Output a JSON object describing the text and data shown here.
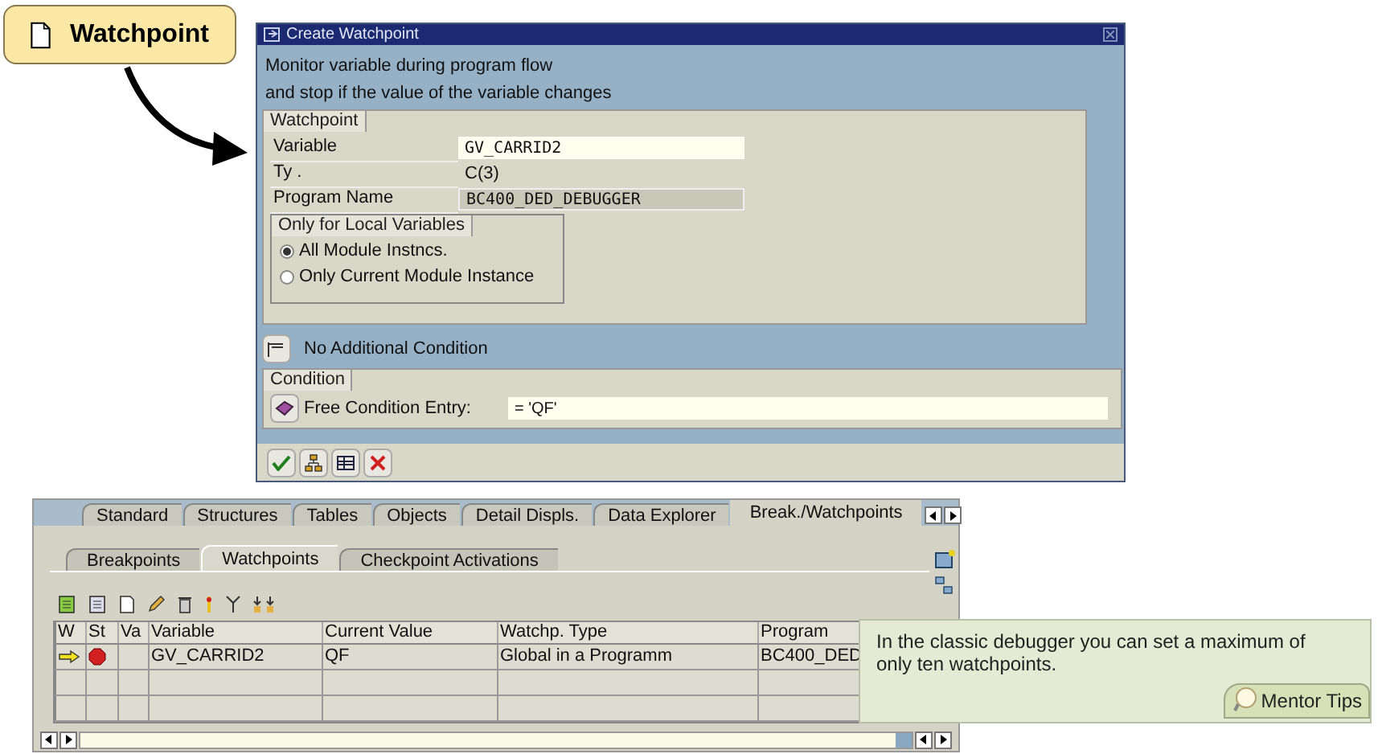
{
  "callout": {
    "label": "Watchpoint"
  },
  "dialog": {
    "title": "Create Watchpoint",
    "intro": [
      "Monitor variable during program flow",
      "and stop if the value of the variable changes"
    ],
    "watchpoint_group": {
      "title": "Watchpoint",
      "fields": [
        {
          "label": "Variable",
          "value": "GV_CARRID2",
          "kind": "input"
        },
        {
          "label": "Ty .",
          "value": "C(3)",
          "kind": "text"
        },
        {
          "label": "Program Name",
          "value": "BC400_DED_DEBUGGER",
          "kind": "readonly"
        }
      ]
    },
    "local_group": {
      "title": "Only for Local Variables",
      "options": [
        {
          "label": "All Module Instncs.",
          "selected": true
        },
        {
          "label": "Only Current Module Instance",
          "selected": false
        }
      ]
    },
    "condition_toggle": "No Additional Condition",
    "condition_group": {
      "title": "Condition",
      "label": "Free Condition Entry:",
      "value": "= 'QF'"
    }
  },
  "debugger": {
    "tabs": [
      {
        "label": "Standard",
        "selected": false
      },
      {
        "label": "Structures",
        "selected": false
      },
      {
        "label": "Tables",
        "selected": false
      },
      {
        "label": "Objects",
        "selected": false
      },
      {
        "label": "Detail Displs.",
        "selected": false
      },
      {
        "label": "Data Explorer",
        "selected": false
      },
      {
        "label": "Break./Watchpoints",
        "selected": true
      }
    ],
    "subtabs": [
      {
        "label": "Breakpoints",
        "selected": false
      },
      {
        "label": "Watchpoints",
        "selected": true
      },
      {
        "label": "Checkpoint Activations",
        "selected": false
      }
    ],
    "table": {
      "columns": [
        "W",
        "St",
        "Va",
        "Variable",
        "Current Value",
        "Watchp. Type",
        "Program"
      ],
      "rows": [
        {
          "cells": [
            "",
            "",
            "",
            "GV_CARRID2",
            "QF",
            "Global in a Programm",
            "BC400_DED"
          ]
        }
      ]
    }
  },
  "tip": {
    "text": "In the classic debugger you can set a maximum of only ten watchpoints.",
    "badge": "Mentor Tips"
  }
}
